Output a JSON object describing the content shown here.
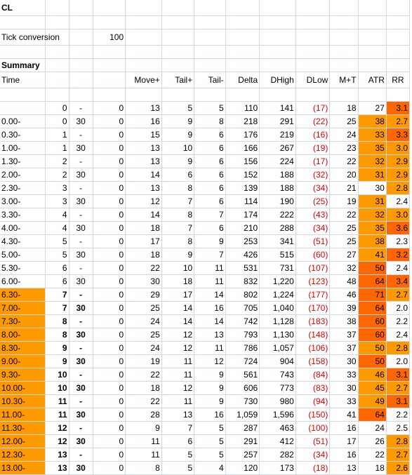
{
  "header": {
    "symbol": "CL",
    "tick_label": "Tick conversion",
    "tick_value": "100",
    "summary_title": "Summary",
    "time_label": "Time"
  },
  "columns": [
    "Move+",
    "Tail+",
    "Tail-",
    "Delta",
    "DHigh",
    "DLow",
    "M+T",
    "ATR",
    "RR"
  ],
  "rows": [
    {
      "time": "",
      "h": "0",
      "m": "-",
      "z": "0",
      "move": "13",
      "tailp": "5",
      "tailm": "5",
      "delta": "110",
      "dhigh": "141",
      "dlow": "(17)",
      "mt": "18",
      "atr": "27",
      "rr": "3.1",
      "hl": false,
      "atr_hl": false,
      "rr_hl": "dorange"
    },
    {
      "time": "0.00-",
      "h": "0",
      "m": "30",
      "z": "0",
      "move": "16",
      "tailp": "9",
      "tailm": "8",
      "delta": "218",
      "dhigh": "291",
      "dlow": "(22)",
      "mt": "25",
      "atr": "38",
      "rr": "2.7",
      "hl": false,
      "atr_hl": "orange",
      "rr_hl": "orange"
    },
    {
      "time": "0.30-",
      "h": "1",
      "m": "-",
      "z": "0",
      "move": "15",
      "tailp": "9",
      "tailm": "6",
      "delta": "176",
      "dhigh": "219",
      "dlow": "(16)",
      "mt": "24",
      "atr": "33",
      "rr": "3.3",
      "hl": false,
      "atr_hl": "orange",
      "rr_hl": "dorange"
    },
    {
      "time": "1.00-",
      "h": "1",
      "m": "30",
      "z": "0",
      "move": "13",
      "tailp": "10",
      "tailm": "6",
      "delta": "166",
      "dhigh": "267",
      "dlow": "(19)",
      "mt": "23",
      "atr": "35",
      "rr": "3.0",
      "hl": false,
      "atr_hl": "orange",
      "rr_hl": "orange"
    },
    {
      "time": "1.30-",
      "h": "2",
      "m": "-",
      "z": "0",
      "move": "13",
      "tailp": "9",
      "tailm": "6",
      "delta": "156",
      "dhigh": "224",
      "dlow": "(17)",
      "mt": "22",
      "atr": "32",
      "rr": "2.9",
      "hl": false,
      "atr_hl": "orange",
      "rr_hl": "orange"
    },
    {
      "time": "2.00-",
      "h": "2",
      "m": "30",
      "z": "0",
      "move": "14",
      "tailp": "6",
      "tailm": "6",
      "delta": "152",
      "dhigh": "188",
      "dlow": "(32)",
      "mt": "20",
      "atr": "31",
      "rr": "2.9",
      "hl": false,
      "atr_hl": "orange",
      "rr_hl": "orange"
    },
    {
      "time": "2.30-",
      "h": "3",
      "m": "-",
      "z": "0",
      "move": "13",
      "tailp": "8",
      "tailm": "6",
      "delta": "139",
      "dhigh": "188",
      "dlow": "(34)",
      "mt": "21",
      "atr": "30",
      "rr": "2.8",
      "hl": false,
      "atr_hl": false,
      "rr_hl": "orange"
    },
    {
      "time": "3.00-",
      "h": "3",
      "m": "30",
      "z": "0",
      "move": "12",
      "tailp": "7",
      "tailm": "6",
      "delta": "114",
      "dhigh": "190",
      "dlow": "(25)",
      "mt": "19",
      "atr": "31",
      "rr": "2.4",
      "hl": false,
      "atr_hl": "orange",
      "rr_hl": false
    },
    {
      "time": "3.30-",
      "h": "4",
      "m": "-",
      "z": "0",
      "move": "14",
      "tailp": "8",
      "tailm": "7",
      "delta": "174",
      "dhigh": "222",
      "dlow": "(43)",
      "mt": "22",
      "atr": "32",
      "rr": "3.0",
      "hl": false,
      "atr_hl": "orange",
      "rr_hl": "orange"
    },
    {
      "time": "4.00-",
      "h": "4",
      "m": "30",
      "z": "0",
      "move": "18",
      "tailp": "7",
      "tailm": "6",
      "delta": "210",
      "dhigh": "288",
      "dlow": "(34)",
      "mt": "25",
      "atr": "35",
      "rr": "3.6",
      "hl": false,
      "atr_hl": "orange",
      "rr_hl": "dorange"
    },
    {
      "time": "4.30-",
      "h": "5",
      "m": "-",
      "z": "0",
      "move": "17",
      "tailp": "8",
      "tailm": "9",
      "delta": "253",
      "dhigh": "341",
      "dlow": "(51)",
      "mt": "25",
      "atr": "38",
      "rr": "2.3",
      "hl": false,
      "atr_hl": "orange",
      "rr_hl": false
    },
    {
      "time": "5.00-",
      "h": "5",
      "m": "30",
      "z": "0",
      "move": "18",
      "tailp": "9",
      "tailm": "7",
      "delta": "426",
      "dhigh": "515",
      "dlow": "(60)",
      "mt": "27",
      "atr": "41",
      "rr": "3.2",
      "hl": false,
      "atr_hl": "orange",
      "rr_hl": "dorange"
    },
    {
      "time": "5.30-",
      "h": "6",
      "m": "-",
      "z": "0",
      "move": "22",
      "tailp": "10",
      "tailm": "11",
      "delta": "531",
      "dhigh": "731",
      "dlow": "(107)",
      "mt": "32",
      "atr": "50",
      "rr": "2.4",
      "hl": false,
      "atr_hl": "dorange",
      "rr_hl": false
    },
    {
      "time": "6.00-",
      "h": "6",
      "m": "30",
      "z": "0",
      "move": "30",
      "tailp": "18",
      "tailm": "11",
      "delta": "832",
      "dhigh": "1,220",
      "dlow": "(123)",
      "mt": "48",
      "atr": "64",
      "rr": "3.4",
      "hl": false,
      "atr_hl": "dorange",
      "rr_hl": "dorange"
    },
    {
      "time": "6.30-",
      "h": "7",
      "m": "-",
      "z": "0",
      "move": "29",
      "tailp": "17",
      "tailm": "14",
      "delta": "802",
      "dhigh": "1,224",
      "dlow": "(177)",
      "mt": "46",
      "atr": "71",
      "rr": "2.7",
      "hl": true,
      "atr_hl": "dorange",
      "rr_hl": "orange"
    },
    {
      "time": "7.00-",
      "h": "7",
      "m": "30",
      "z": "0",
      "move": "25",
      "tailp": "14",
      "tailm": "16",
      "delta": "705",
      "dhigh": "1,040",
      "dlow": "(170)",
      "mt": "39",
      "atr": "64",
      "rr": "2.0",
      "hl": true,
      "atr_hl": "dorange",
      "rr_hl": false
    },
    {
      "time": "7.30-",
      "h": "8",
      "m": "-",
      "z": "0",
      "move": "24",
      "tailp": "14",
      "tailm": "14",
      "delta": "742",
      "dhigh": "1,128",
      "dlow": "(183)",
      "mt": "38",
      "atr": "60",
      "rr": "2.2",
      "hl": true,
      "atr_hl": "dorange",
      "rr_hl": false
    },
    {
      "time": "8.00-",
      "h": "8",
      "m": "30",
      "z": "0",
      "move": "25",
      "tailp": "12",
      "tailm": "13",
      "delta": "793",
      "dhigh": "1,130",
      "dlow": "(148)",
      "mt": "37",
      "atr": "60",
      "rr": "2.4",
      "hl": true,
      "atr_hl": "dorange",
      "rr_hl": false
    },
    {
      "time": "8.30-",
      "h": "9",
      "m": "-",
      "z": "0",
      "move": "24",
      "tailp": "12",
      "tailm": "11",
      "delta": "786",
      "dhigh": "1,057",
      "dlow": "(106)",
      "mt": "37",
      "atr": "50",
      "rr": "2.8",
      "hl": true,
      "atr_hl": "orange",
      "rr_hl": "orange"
    },
    {
      "time": "9.00-",
      "h": "9",
      "m": "30",
      "z": "0",
      "move": "19",
      "tailp": "11",
      "tailm": "12",
      "delta": "724",
      "dhigh": "904",
      "dlow": "(158)",
      "mt": "30",
      "atr": "50",
      "rr": "2.0",
      "hl": true,
      "atr_hl": "dorange",
      "rr_hl": false
    },
    {
      "time": "9.30-",
      "h": "10",
      "m": "-",
      "z": "0",
      "move": "22",
      "tailp": "11",
      "tailm": "9",
      "delta": "561",
      "dhigh": "743",
      "dlow": "(84)",
      "mt": "33",
      "atr": "46",
      "rr": "3.1",
      "hl": true,
      "atr_hl": "orange",
      "rr_hl": "dorange"
    },
    {
      "time": "10.00-",
      "h": "10",
      "m": "30",
      "z": "0",
      "move": "18",
      "tailp": "12",
      "tailm": "9",
      "delta": "606",
      "dhigh": "773",
      "dlow": "(83)",
      "mt": "30",
      "atr": "45",
      "rr": "2.7",
      "hl": true,
      "atr_hl": "orange",
      "rr_hl": "orange"
    },
    {
      "time": "10.30-",
      "h": "11",
      "m": "-",
      "z": "0",
      "move": "22",
      "tailp": "11",
      "tailm": "9",
      "delta": "730",
      "dhigh": "980",
      "dlow": "(94)",
      "mt": "33",
      "atr": "49",
      "rr": "3.1",
      "hl": true,
      "atr_hl": "orange",
      "rr_hl": "dorange"
    },
    {
      "time": "11.00-",
      "h": "11",
      "m": "30",
      "z": "0",
      "move": "28",
      "tailp": "13",
      "tailm": "16",
      "delta": "1,059",
      "dhigh": "1,596",
      "dlow": "(150)",
      "mt": "41",
      "atr": "64",
      "rr": "2.2",
      "hl": true,
      "atr_hl": "dorange",
      "rr_hl": false
    },
    {
      "time": "11.30-",
      "h": "12",
      "m": "-",
      "z": "0",
      "move": "9",
      "tailp": "7",
      "tailm": "5",
      "delta": "287",
      "dhigh": "463",
      "dlow": "(100)",
      "mt": "16",
      "atr": "24",
      "rr": "2.5",
      "hl": true,
      "atr_hl": false,
      "rr_hl": false
    },
    {
      "time": "12.00-",
      "h": "12",
      "m": "30",
      "z": "0",
      "move": "11",
      "tailp": "6",
      "tailm": "5",
      "delta": "291",
      "dhigh": "412",
      "dlow": "(51)",
      "mt": "17",
      "atr": "26",
      "rr": "2.8",
      "hl": true,
      "atr_hl": false,
      "rr_hl": "orange"
    },
    {
      "time": "12.30-",
      "h": "13",
      "m": "-",
      "z": "0",
      "move": "11",
      "tailp": "5",
      "tailm": "5",
      "delta": "257",
      "dhigh": "282",
      "dlow": "(34)",
      "mt": "16",
      "atr": "22",
      "rr": "2.7",
      "hl": true,
      "atr_hl": false,
      "rr_hl": "orange"
    },
    {
      "time": "13.00-",
      "h": "13",
      "m": "30",
      "z": "0",
      "move": "8",
      "tailp": "5",
      "tailm": "4",
      "delta": "120",
      "dhigh": "173",
      "dlow": "(18)",
      "mt": "13",
      "atr": "18",
      "rr": "2.6",
      "hl": true,
      "atr_hl": false,
      "rr_hl": "orange"
    }
  ],
  "colors": {
    "orange": "#ff9900",
    "dark_orange": "#ff6600",
    "negative": "#e00000"
  }
}
